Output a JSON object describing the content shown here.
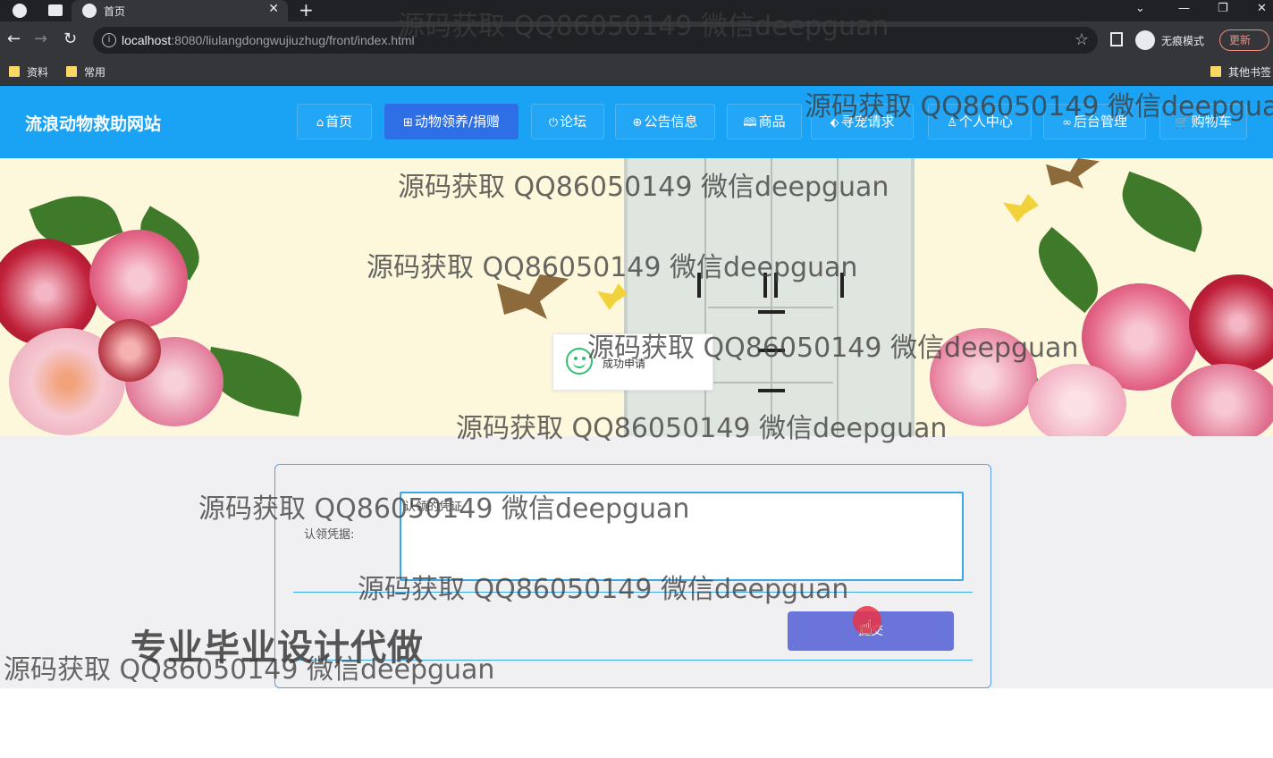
{
  "browser": {
    "tab_title": "首页",
    "url_host": "localhost",
    "url_rest": ":8080/liulangdongwujiuzhug/front/index.html",
    "incognito_label": "无痕模式",
    "update_label": "更新",
    "bookmarks": [
      "资料",
      "常用",
      "其他书签"
    ]
  },
  "site": {
    "title": "流浪动物救助网站",
    "nav": [
      {
        "label": "首页",
        "icon": "home-icon",
        "glyph": "⌂"
      },
      {
        "label": "动物领养/捐赠",
        "icon": "grid-icon",
        "glyph": "⊞"
      },
      {
        "label": "论坛",
        "icon": "power-icon",
        "glyph": "⏻"
      },
      {
        "label": "公告信息",
        "icon": "globe-icon",
        "glyph": "⊕"
      },
      {
        "label": "商品",
        "icon": "book-icon",
        "glyph": "🕮"
      },
      {
        "label": "寻宠请求",
        "icon": "tag-icon",
        "glyph": "⬖"
      },
      {
        "label": "个人中心",
        "icon": "user-icon",
        "glyph": "♙"
      },
      {
        "label": "后台管理",
        "icon": "link-icon",
        "glyph": "∞"
      },
      {
        "label": "购物车",
        "icon": "cart-icon",
        "glyph": "🛒"
      }
    ],
    "active_nav_index": 1
  },
  "toast": {
    "message": "成功申请"
  },
  "form": {
    "label": "认领凭据:",
    "value": "认领的凭证",
    "submit_label": "提交"
  },
  "promo_text": "专业毕业设计代做",
  "watermark": "源码获取 QQ86050149 微信deepguan",
  "colors": {
    "header": "#1aa3f5",
    "nav_active": "#2f6fe6",
    "submit": "#6b74d8",
    "toast_icon": "#2fbf71"
  }
}
